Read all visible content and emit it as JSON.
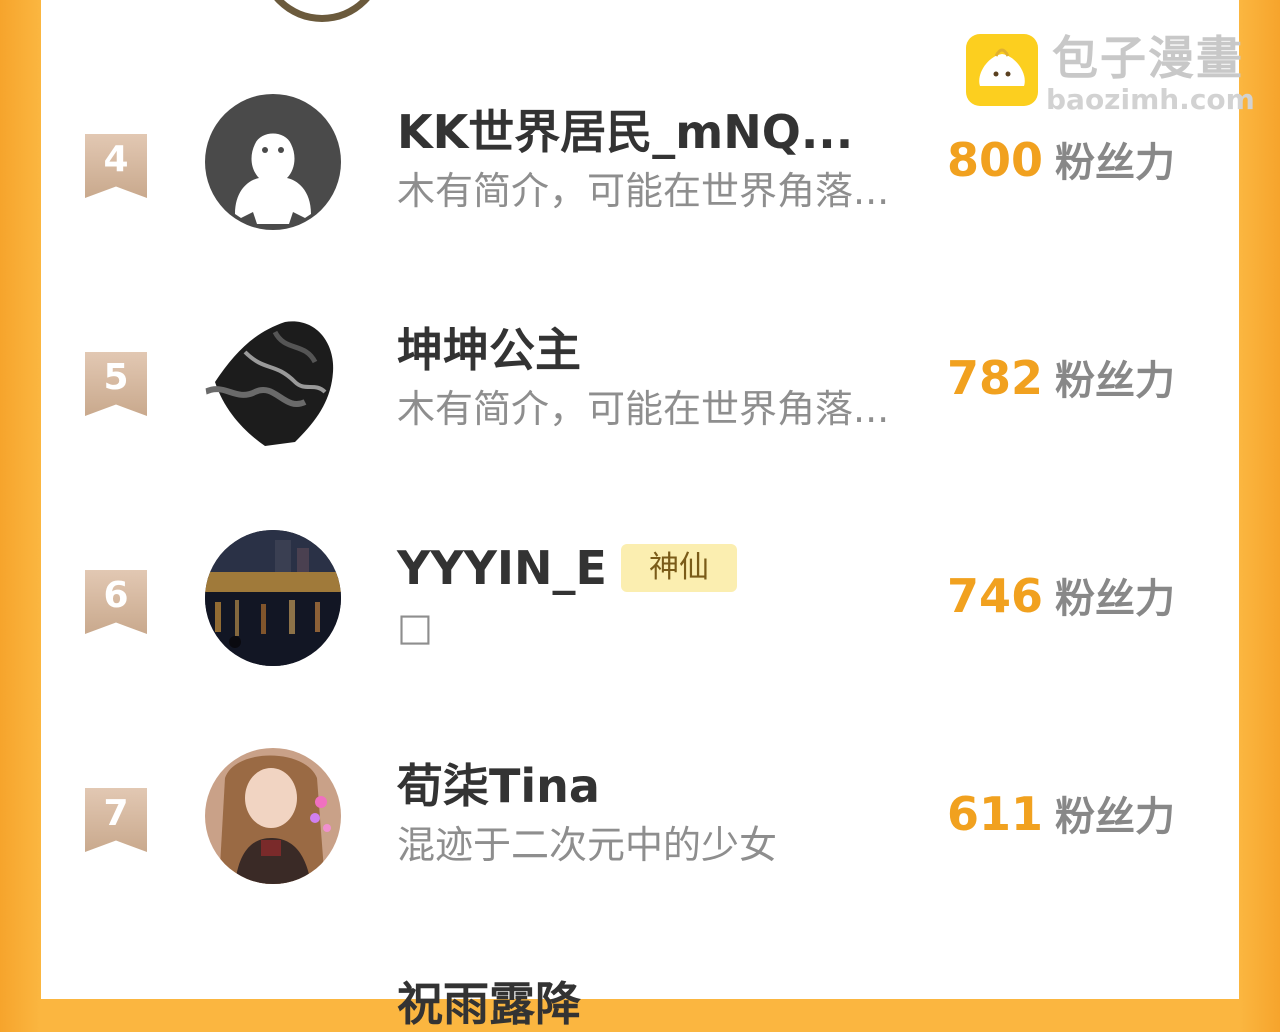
{
  "watermark": {
    "title": "包子漫畫",
    "url": "baozimh.com"
  },
  "colors": {
    "accent": "#f1a11f",
    "frame": "#fbb640",
    "rank_badge": "#d8bca5",
    "badge_bg": "#fbeeb0"
  },
  "ranking": [
    {
      "rank": "4",
      "name": "KK世界居民_mNQ...",
      "bio": "木有简介，可能在世界角落...",
      "fans": "800",
      "fans_label": "粉丝力",
      "avatar": "default-ghost-avatar"
    },
    {
      "rank": "5",
      "name": "坤坤公主",
      "bio": "木有简介，可能在世界角落...",
      "fans": "782",
      "fans_label": "粉丝力",
      "avatar": "dark-ink-avatar"
    },
    {
      "rank": "6",
      "name": "YYYIN_E",
      "badge": "神仙",
      "bio": "□",
      "fans": "746",
      "fans_label": "粉丝力",
      "avatar": "night-river-avatar"
    },
    {
      "rank": "7",
      "name": "荀柒Tina",
      "bio": "混迹于二次元中的少女",
      "fans": "611",
      "fans_label": "粉丝力",
      "avatar": "girl-photo-avatar"
    }
  ],
  "partial_next_name": "祝雨露降"
}
